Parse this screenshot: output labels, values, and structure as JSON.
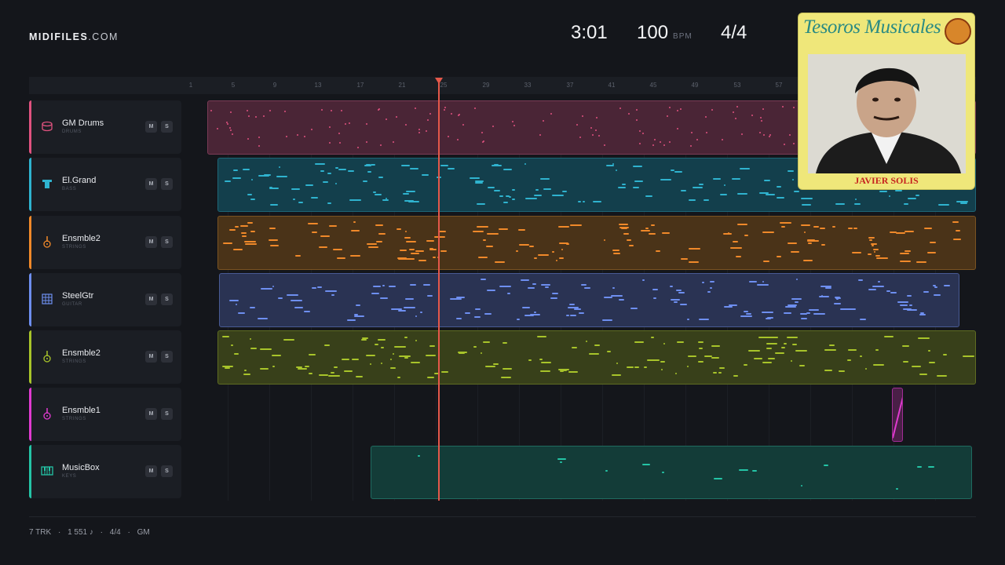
{
  "brand": {
    "name": "MIDIFILES",
    "suffix": ".COM"
  },
  "transport": {
    "time": "3:01",
    "bpm": "100",
    "bpm_unit": "BPM",
    "signature": "4/4"
  },
  "ruler": [
    "1",
    "5",
    "9",
    "13",
    "17",
    "21",
    "25",
    "29",
    "33",
    "37",
    "41",
    "45",
    "49",
    "53",
    "57"
  ],
  "playhead": {
    "bar": 25
  },
  "tracks": [
    {
      "name": "GM Drums",
      "category": "DRUMS",
      "color": "#e0527f",
      "icon": "drum-icon",
      "mute": "M",
      "solo": "S"
    },
    {
      "name": "El.Grand",
      "category": "BASS",
      "color": "#2fb3cf",
      "icon": "bass-icon",
      "mute": "M",
      "solo": "S"
    },
    {
      "name": "Ensmble2",
      "category": "STRINGS",
      "color": "#f0892a",
      "icon": "guitar-icon",
      "mute": "M",
      "solo": "S"
    },
    {
      "name": "SteelGtr",
      "category": "GUITAR",
      "color": "#6e8ff0",
      "icon": "guitar-grid-icon",
      "mute": "M",
      "solo": "S"
    },
    {
      "name": "Ensmble2",
      "category": "STRINGS",
      "color": "#a8c42a",
      "icon": "guitar-icon",
      "mute": "M",
      "solo": "S"
    },
    {
      "name": "Ensmble1",
      "category": "STRINGS",
      "color": "#e03ad0",
      "icon": "guitar-icon",
      "mute": "M",
      "solo": "S"
    },
    {
      "name": "MusicBox",
      "category": "KEYS",
      "color": "#24c4a6",
      "icon": "keyboard-icon",
      "mute": "M",
      "solo": "S"
    }
  ],
  "footer": {
    "tracks": "7 TRK",
    "notes": "1 551 ♪",
    "signature": "4/4",
    "standard": "GM",
    "sep": "·"
  },
  "album": {
    "title": "Tesoros Musicales",
    "artist": "JAVIER SOLIS"
  }
}
